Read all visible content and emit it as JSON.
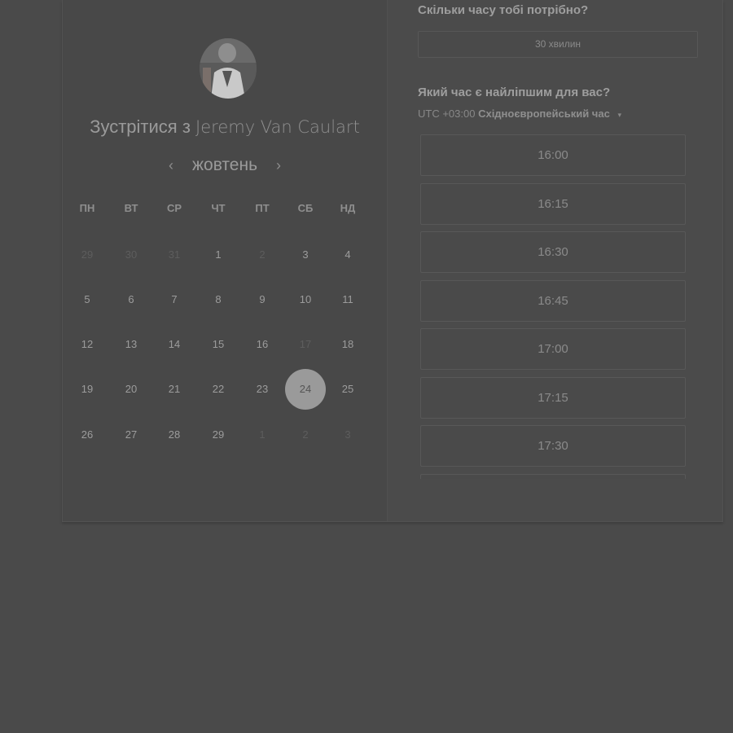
{
  "left": {
    "meet_prefix": "Зустрітися з",
    "host_name": "Jeremy Van Caulart",
    "month": "жовтень",
    "prev_icon": "‹",
    "next_icon": "›",
    "weekdays": [
      "ПН",
      "ВТ",
      "СР",
      "ЧТ",
      "ПТ",
      "СБ",
      "НД"
    ],
    "days": [
      [
        "29",
        "30",
        "31",
        "1",
        "2",
        "3",
        "4"
      ],
      [
        "5",
        "6",
        "7",
        "8",
        "9",
        "10",
        "11"
      ],
      [
        "12",
        "13",
        "14",
        "15",
        "16",
        "17",
        "18"
      ],
      [
        "19",
        "20",
        "21",
        "22",
        "23",
        "24",
        "25"
      ],
      [
        "26",
        "27",
        "28",
        "29",
        "1",
        "2",
        "3"
      ]
    ],
    "selected_day": "24"
  },
  "right": {
    "duration_question": "Скільки часу тобі потрібно?",
    "duration_value": "30 хвилин",
    "time_question": "Який час є найліпшим для вас?",
    "tz_offset": "UTC +03:00",
    "tz_name": "Східноєвропейський час",
    "tz_caret": "▾",
    "slots": [
      "16:00",
      "16:15",
      "16:30",
      "16:45",
      "17:00",
      "17:15",
      "17:30"
    ]
  }
}
